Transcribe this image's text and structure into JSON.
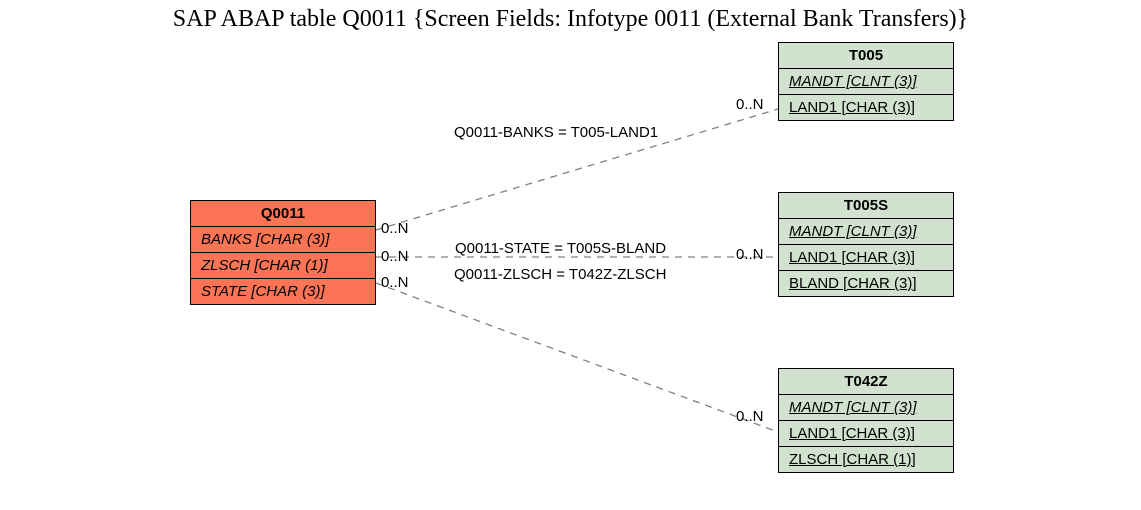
{
  "title": "SAP ABAP table Q0011 {Screen Fields: Infotype 0011 (External Bank Transfers)}",
  "q0011": {
    "name": "Q0011",
    "fields": {
      "banks": "BANKS [CHAR (3)]",
      "zlsch": "ZLSCH [CHAR (1)]",
      "state": "STATE [CHAR (3)]"
    }
  },
  "t005": {
    "name": "T005",
    "mandt": "MANDT [CLNT (3)]",
    "land1": "LAND1 [CHAR (3)]"
  },
  "t005s": {
    "name": "T005S",
    "mandt": "MANDT [CLNT (3)]",
    "land1": "LAND1 [CHAR (3)]",
    "bland": "BLAND [CHAR (3)]"
  },
  "t042z": {
    "name": "T042Z",
    "mandt": "MANDT [CLNT (3)]",
    "land1": "LAND1 [CHAR (3)]",
    "zlsch": "ZLSCH [CHAR (1)]"
  },
  "rels": {
    "r1": "Q0011-BANKS = T005-LAND1",
    "r2": "Q0011-STATE = T005S-BLAND",
    "r3": "Q0011-ZLSCH = T042Z-ZLSCH"
  },
  "card": {
    "c1l": "0..N",
    "c1r": "0..N",
    "c2l": "0..N",
    "c2r": "0..N",
    "c3l": "0..N",
    "c3r": "0..N"
  }
}
